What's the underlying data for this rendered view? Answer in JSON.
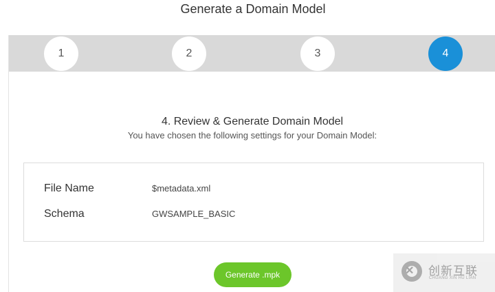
{
  "page": {
    "title": "Generate a Domain Model"
  },
  "wizard": {
    "steps": [
      {
        "label": "1",
        "active": false
      },
      {
        "label": "2",
        "active": false
      },
      {
        "label": "3",
        "active": false
      },
      {
        "label": "4",
        "active": true
      }
    ],
    "active_color": "#1a90d8",
    "inactive_color": "#ffffff",
    "bar_color": "#d9d9d9"
  },
  "review": {
    "heading": "4. Review & Generate Domain Model",
    "subheading": "You have chosen the following settings for your Domain Model:",
    "settings": [
      {
        "label": "File Name",
        "value": "$metadata.xml"
      },
      {
        "label": "Schema",
        "value": "GWSAMPLE_BASIC"
      }
    ]
  },
  "actions": {
    "generate_label": "Generate .mpk",
    "generate_color": "#6cc62a"
  },
  "watermark": {
    "text_cn": "创新互联",
    "text_en": "CHUANG XIN HU LIAN",
    "logo_icon": "cx-logo-icon"
  }
}
